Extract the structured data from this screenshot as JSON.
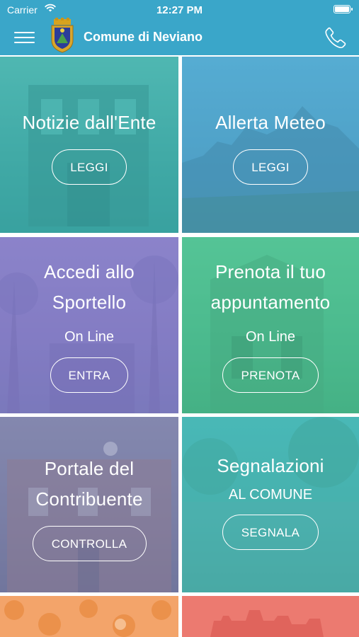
{
  "status": {
    "carrier": "Carrier",
    "time": "12:27 PM"
  },
  "app": {
    "title": "Comune di Neviano"
  },
  "colors": {
    "header": "#3aa6c9",
    "teal": "#3fb7c2",
    "purple": "#8a7fc4",
    "green": "#4dbf93",
    "steel": "#7d86a8",
    "peach": "#f3a46a",
    "coral": "#ec7a70"
  },
  "icons": {
    "menu": "hamburger-menu-icon",
    "phone": "phone-icon",
    "wifi": "wifi-icon",
    "battery": "battery-icon",
    "crest": "coat-of-arms-icon"
  },
  "tiles": [
    {
      "title": "Notizie dall'Ente",
      "button": "LEGGI"
    },
    {
      "title": "Allerta Meteo",
      "button": "LEGGI"
    },
    {
      "title_line1": "Accedi allo",
      "title_line2": "Sportello",
      "subtitle": "On Line",
      "button": "ENTRA"
    },
    {
      "title_line1": "Prenota il tuo",
      "title_line2": "appuntamento",
      "subtitle": "On Line",
      "button": "PRENOTA"
    },
    {
      "title_line1": "Portale del",
      "title_line2": "Contribuente",
      "button": "CONTROLLA"
    },
    {
      "title": "Segnalazioni",
      "subtitle": "AL COMUNE",
      "button": "SEGNALA"
    }
  ]
}
